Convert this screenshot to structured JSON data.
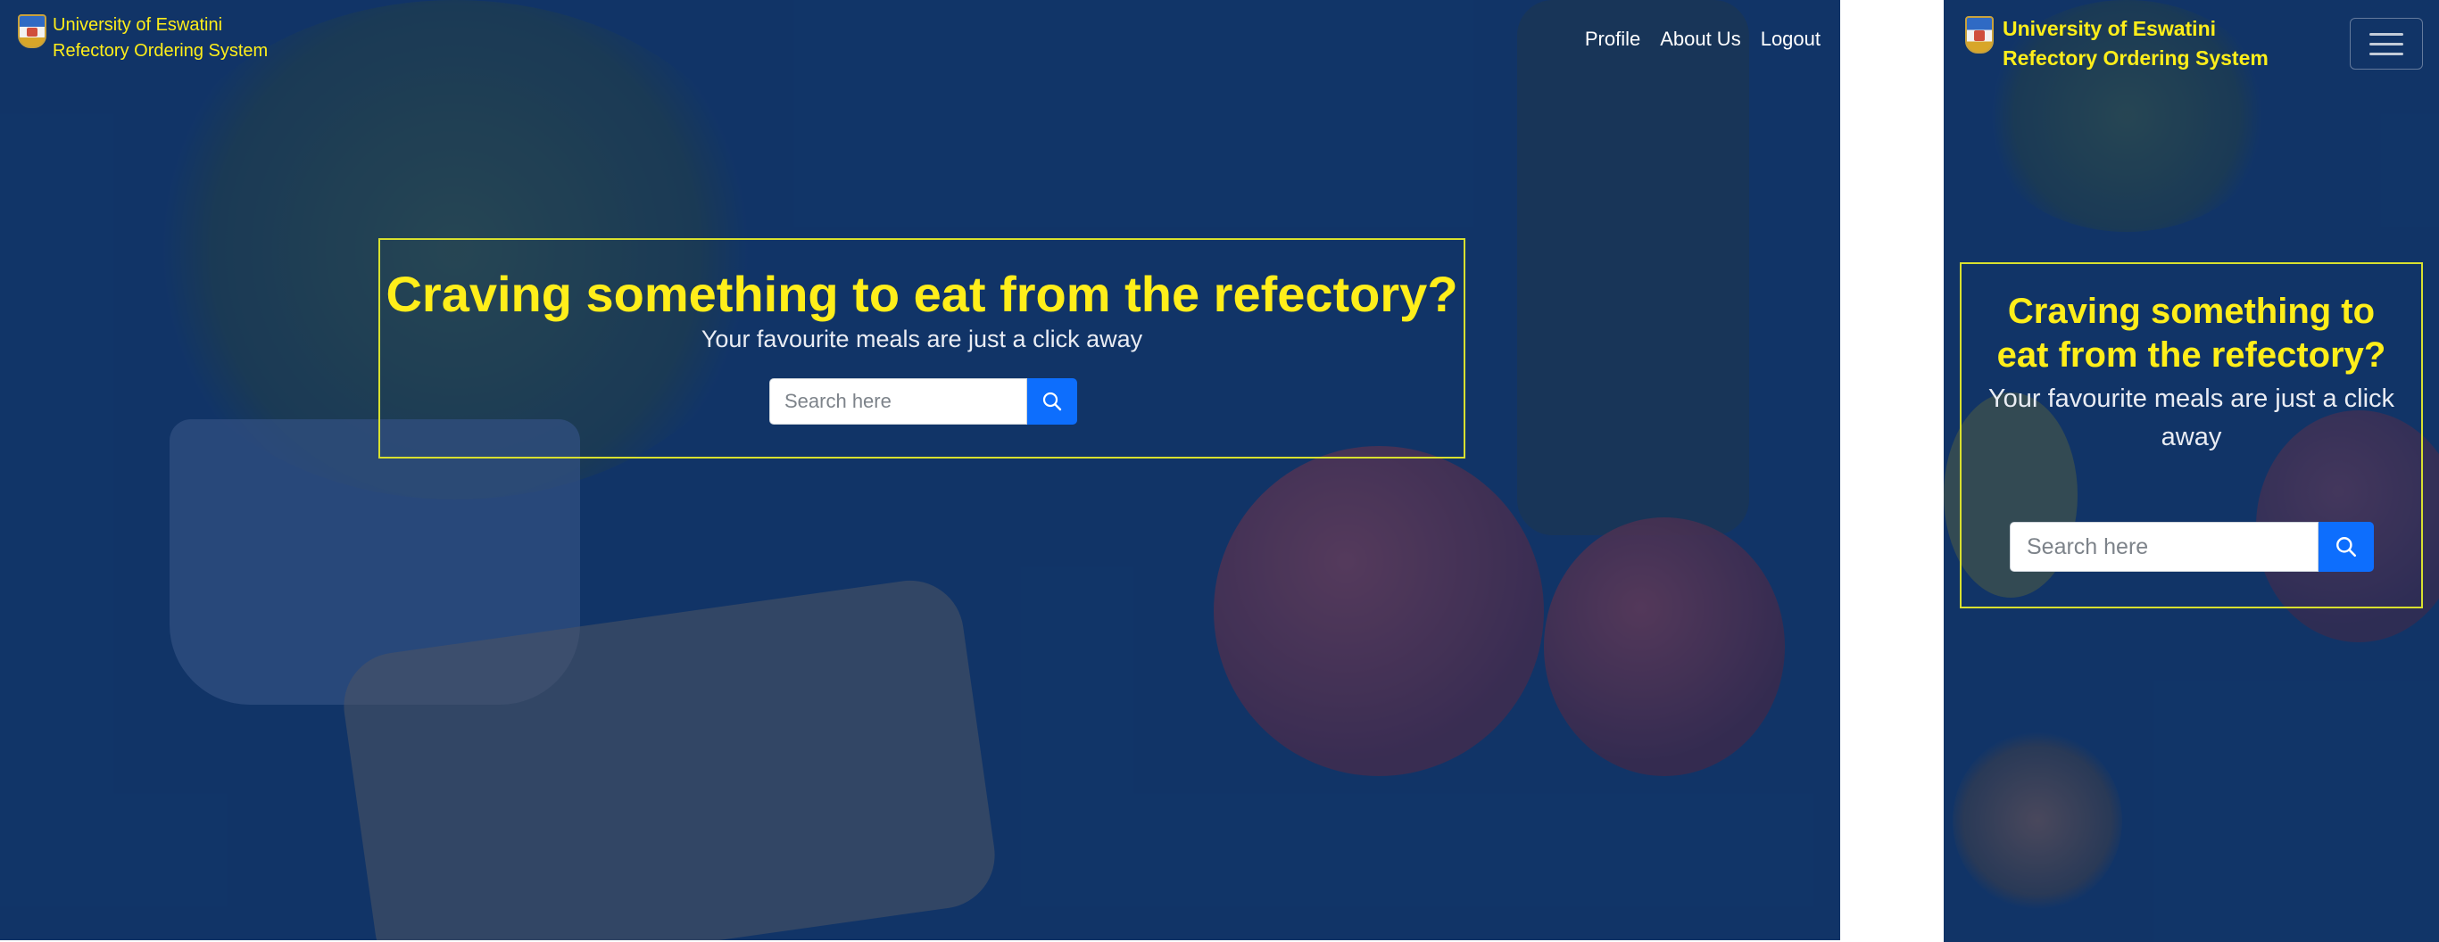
{
  "brand": {
    "line1": "University of Eswatini",
    "line2": "Refectory Ordering System"
  },
  "nav": {
    "links": [
      "Profile",
      "About Us",
      "Logout"
    ]
  },
  "hero": {
    "title": "Craving something to eat from the refectory?",
    "subtitle": "Your favourite meals are just a click away"
  },
  "search": {
    "placeholder": "Search here",
    "button_icon": "search-icon"
  },
  "mobile": {
    "menu_icon": "hamburger-menu-icon"
  },
  "colors": {
    "overlay": "#133b6c",
    "brand_yellow": "#ffee1a",
    "hero_border": "#d8e02f",
    "search_button": "#0d6efd"
  }
}
